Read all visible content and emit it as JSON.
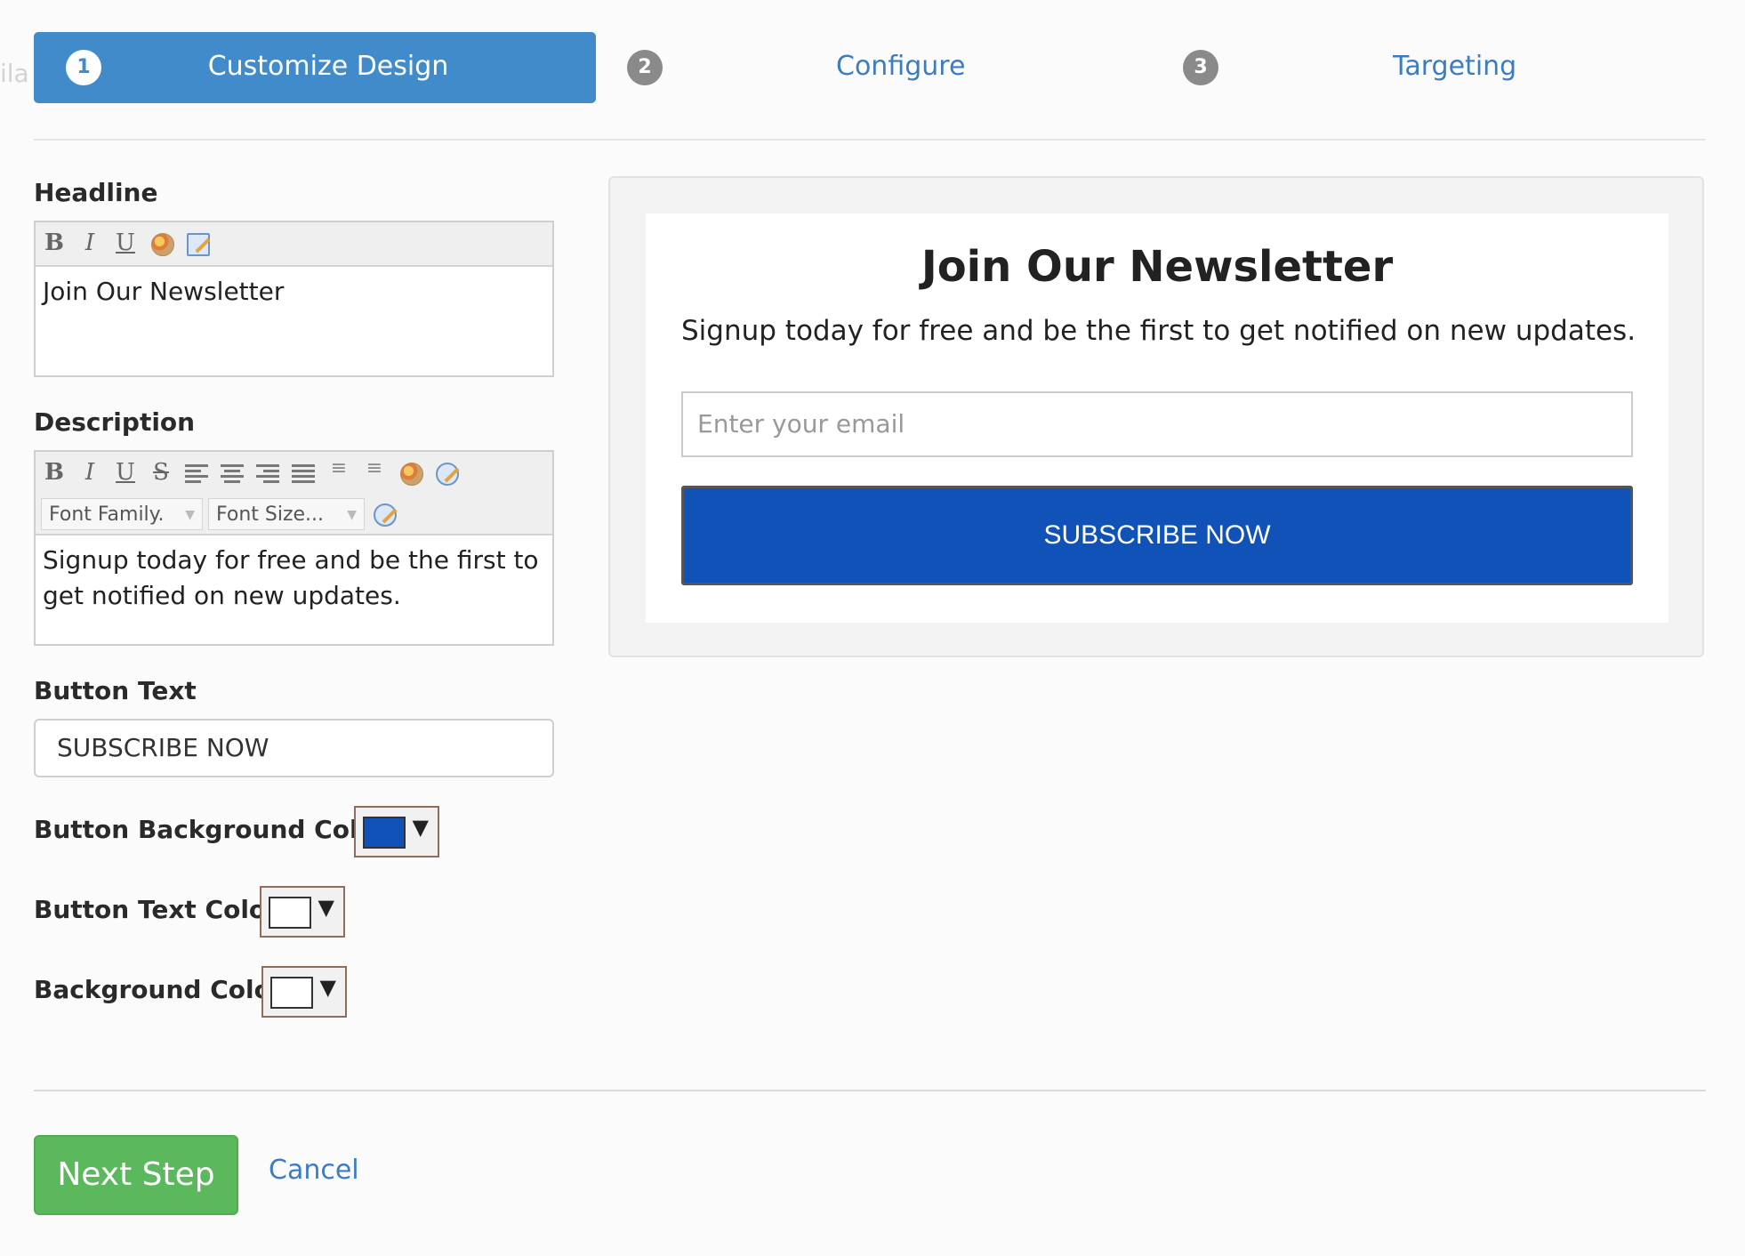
{
  "stepper": {
    "ghost_text": "ila",
    "steps": [
      {
        "number": "1",
        "label": "Customize Design",
        "state": "active"
      },
      {
        "number": "2",
        "label": "Configure",
        "state": "inactive"
      },
      {
        "number": "3",
        "label": "Targeting",
        "state": "inactive"
      }
    ]
  },
  "form": {
    "headline": {
      "label": "Headline",
      "toolbar_icons": [
        "bold-icon",
        "italic-icon",
        "underline-icon",
        "color-palette-icon",
        "edit-source-icon"
      ],
      "value": "Join Our Newsletter"
    },
    "description": {
      "label": "Description",
      "toolbar_icons": [
        "bold-icon",
        "italic-icon",
        "underline-icon",
        "strikethrough-icon",
        "align-left-icon",
        "align-center-icon",
        "align-right-icon",
        "align-justify-icon",
        "ordered-list-icon",
        "unordered-list-icon",
        "color-palette-icon",
        "edit-source-icon",
        "edit-icon"
      ],
      "font_family_placeholder": "Font Family.",
      "font_size_placeholder": "Font Size...",
      "value": "Signup today for free and be the first to get notified on new updates."
    },
    "button_text": {
      "label": "Button Text",
      "value": "SUBSCRIBE NOW"
    },
    "button_background_color": {
      "label": "Button Background Color",
      "color": "#1052b8"
    },
    "button_text_color": {
      "label": "Button Text Color",
      "color": "#ffffff"
    },
    "background_color": {
      "label": "Background Color",
      "color": "#ffffff"
    }
  },
  "preview": {
    "title": "Join Our Newsletter",
    "description": "Signup today for free and be the first to get notified on new updates.",
    "email_placeholder": "Enter your email",
    "button_label": "SUBSCRIBE NOW",
    "button_bg": "#1052b8",
    "button_fg": "#ffffff",
    "card_bg": "#ffffff"
  },
  "footer": {
    "next_label": "Next Step",
    "cancel_label": "Cancel"
  },
  "colors": {
    "accent": "#428bca",
    "link": "#3b7dc0",
    "success": "#5cb85c"
  }
}
